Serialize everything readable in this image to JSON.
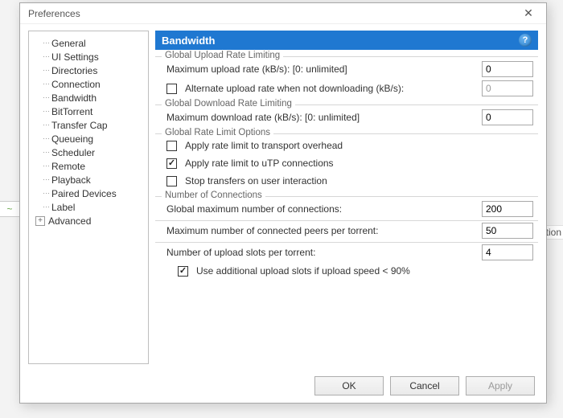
{
  "window": {
    "title": "Preferences"
  },
  "bg": {
    "left_icon": "~",
    "right_text": "ation"
  },
  "tree": {
    "items": [
      "General",
      "UI Settings",
      "Directories",
      "Connection",
      "Bandwidth",
      "BitTorrent",
      "Transfer Cap",
      "Queueing",
      "Scheduler",
      "Remote",
      "Playback",
      "Paired Devices",
      "Label"
    ],
    "expandable": "Advanced",
    "selected_index": 4
  },
  "panel": {
    "title": "Bandwidth",
    "help_glyph": "?",
    "groups": {
      "upload": {
        "legend": "Global Upload Rate Limiting",
        "max_label": "Maximum upload rate (kB/s): [0: unlimited]",
        "max_value": "0",
        "alt_label": "Alternate upload rate when not downloading (kB/s):",
        "alt_checked": false,
        "alt_value": "0"
      },
      "download": {
        "legend": "Global Download Rate Limiting",
        "max_label": "Maximum download rate (kB/s): [0: unlimited]",
        "max_value": "0"
      },
      "options": {
        "legend": "Global Rate Limit Options",
        "overhead_label": "Apply rate limit to transport overhead",
        "overhead_checked": false,
        "utp_label": "Apply rate limit to uTP connections",
        "utp_checked": true,
        "stop_label": "Stop transfers on user interaction",
        "stop_checked": false
      },
      "connections": {
        "legend": "Number of Connections",
        "global_label": "Global maximum number of connections:",
        "global_value": "200",
        "peers_label": "Maximum number of connected peers per torrent:",
        "peers_value": "50",
        "slots_label": "Number of upload slots per torrent:",
        "slots_value": "4",
        "extra_slots_label": "Use additional upload slots if upload speed < 90%",
        "extra_slots_checked": true
      }
    }
  },
  "footer": {
    "ok": "OK",
    "cancel": "Cancel",
    "apply": "Apply"
  }
}
